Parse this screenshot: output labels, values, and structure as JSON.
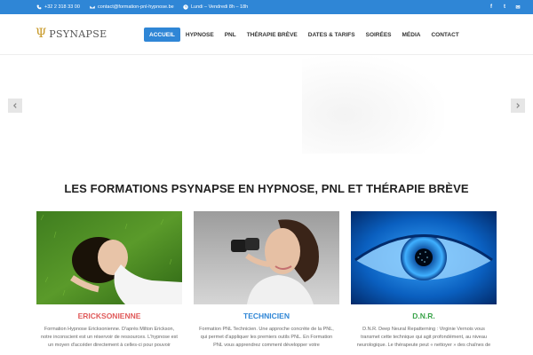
{
  "topbar": {
    "phone": "+32 2 318 33 00",
    "email": "contact@formation-pnl-hypnose.be",
    "hours": "Lundi – Vendredi 8h – 18h",
    "social_icons": [
      "facebook-icon",
      "twitter-icon",
      "mail-icon"
    ],
    "social_glyphs": {
      "facebook": "f",
      "twitter": "t",
      "mail": "✉"
    }
  },
  "header": {
    "logo_glyph": "Ψ",
    "logo_text": "PSYNAPSE",
    "nav": [
      {
        "label": "ACCUEIL",
        "active": true
      },
      {
        "label": "HYPNOSE",
        "active": false
      },
      {
        "label": "PNL",
        "active": false
      },
      {
        "label": "THÉRAPIE BRÈVE",
        "active": false
      },
      {
        "label": "DATES & TARIFS",
        "active": false
      },
      {
        "label": "SOIRÉES",
        "active": false
      },
      {
        "label": "MÉDIA",
        "active": false
      },
      {
        "label": "CONTACT",
        "active": false
      }
    ]
  },
  "section_title": "LES FORMATIONS PSYNAPSE EN HYPNOSE, PNL ET THÉRAPIE BRÈVE",
  "cards": [
    {
      "caption": "ERICKSONIENNE",
      "caption_color": "#e05a5a",
      "description": "Formation Hypnose Ericksonienne. D'après Milton Erickson, notre inconscient est un réservoir de ressources. L'hypnose est un moyen d'accéder directement à celles-ci pour pouvoir"
    },
    {
      "caption": "TECHNICIEN",
      "caption_color": "#2f86d6",
      "description": "Formation PNL Technicien. Une approche concrète de la PNL, qui permet d'appliquer les premiers outils PNL. En Formation PNL vous apprendrez comment développer votre"
    },
    {
      "caption": "D.N.R.",
      "caption_color": "#3aa34a",
      "description": "D.N.R. Deep Neural Repatterning : Virginie Vernois vous transmet cette technique qui agit profondément, au niveau neurologique. Le thérapeute peut « nettoyer » des chaînes de"
    }
  ],
  "colors": {
    "accent": "#2f86d6"
  }
}
